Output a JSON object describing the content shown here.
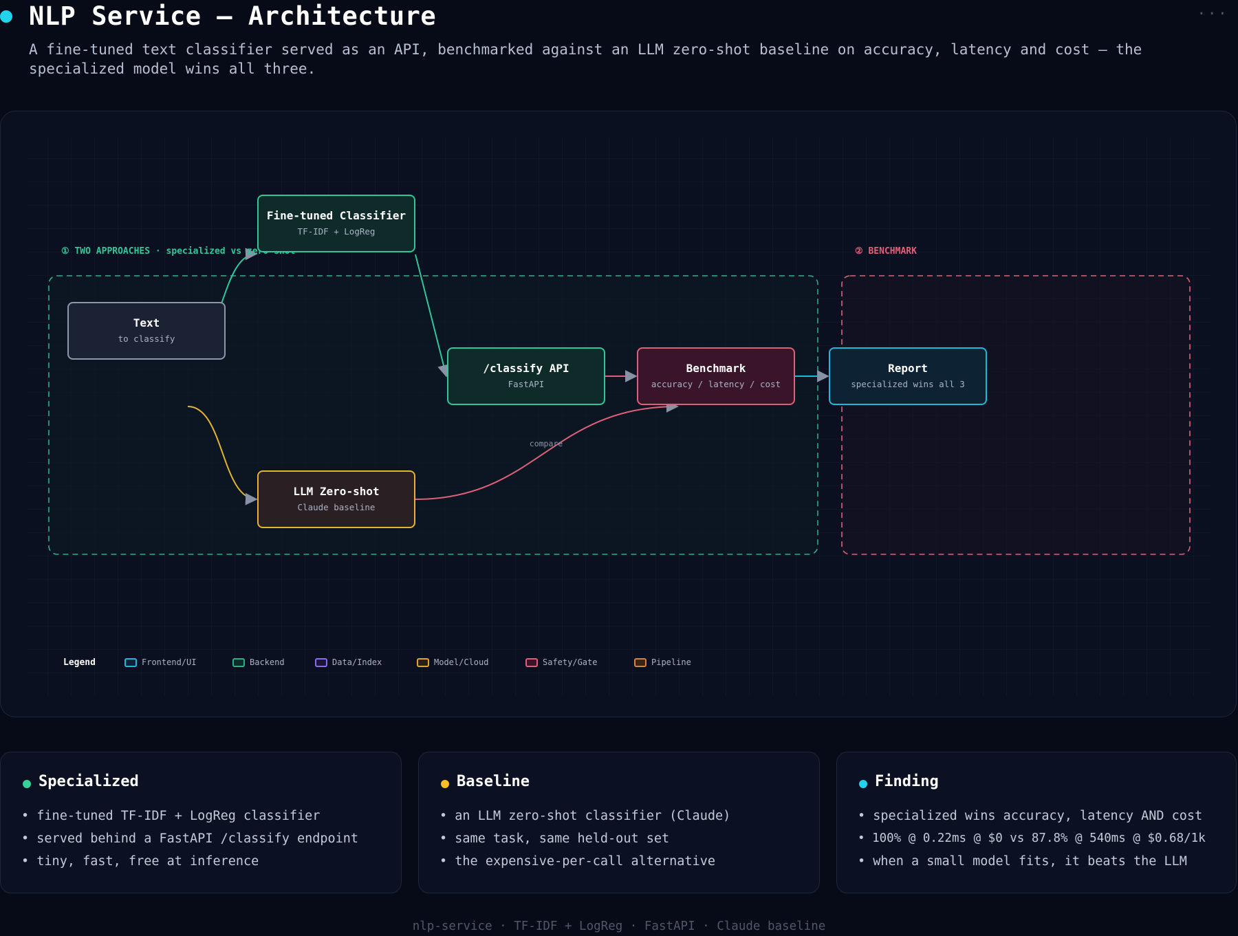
{
  "header": {
    "title": "NLP Service — Architecture",
    "subtitle": "A fine-tuned text classifier served as an API, benchmarked against an LLM zero-shot baseline on accuracy, latency and cost — the specialized model wins all three.",
    "more_icon": "more-icon"
  },
  "groups": {
    "approaches": "① TWO APPROACHES · specialized vs zero-shot",
    "benchmark": "② BENCHMARK"
  },
  "nodes": {
    "text": {
      "title": "Text",
      "sub": "to classify"
    },
    "classifier": {
      "title": "Fine-tuned Classifier",
      "sub": "TF-IDF + LogReg"
    },
    "llm": {
      "title": "LLM Zero-shot",
      "sub": "Claude baseline"
    },
    "api": {
      "title": "/classify API",
      "sub": "FastAPI"
    },
    "benchmark": {
      "title": "Benchmark",
      "sub": "accuracy / latency / cost"
    },
    "report": {
      "title": "Report",
      "sub": "specialized wins all 3"
    }
  },
  "edges": {
    "compare_label": "compare"
  },
  "legend": {
    "title": "Legend",
    "items": [
      {
        "label": "Frontend/UI",
        "color": "#22b8dc"
      },
      {
        "label": "Backend",
        "color": "#2fae86"
      },
      {
        "label": "Data/Index",
        "color": "#8b6cf0"
      },
      {
        "label": "Model/Cloud",
        "color": "#e0a52a"
      },
      {
        "label": "Safety/Gate",
        "color": "#e0607a"
      },
      {
        "label": "Pipeline",
        "color": "#d08547"
      }
    ]
  },
  "cards": [
    {
      "title": "Specialized",
      "dot_color": "#34d399",
      "items": [
        "fine-tuned TF-IDF + LogReg classifier",
        "served behind a FastAPI /classify endpoint",
        "tiny, fast, free at inference"
      ]
    },
    {
      "title": "Baseline",
      "dot_color": "#fbbf24",
      "items": [
        "an LLM zero-shot classifier (Claude)",
        "same task, same held-out set",
        "the expensive-per-call alternative"
      ]
    },
    {
      "title": "Finding",
      "dot_color": "#22d3ee",
      "items": [
        "specialized wins accuracy, latency AND cost",
        "100% @ 0.22ms @ $0 vs 87.8% @ 540ms @ $0.68/1k",
        "when a small model fits, it beats the LLM"
      ]
    }
  ],
  "footer": "nlp-service · TF-IDF + LogReg · FastAPI · Claude baseline"
}
